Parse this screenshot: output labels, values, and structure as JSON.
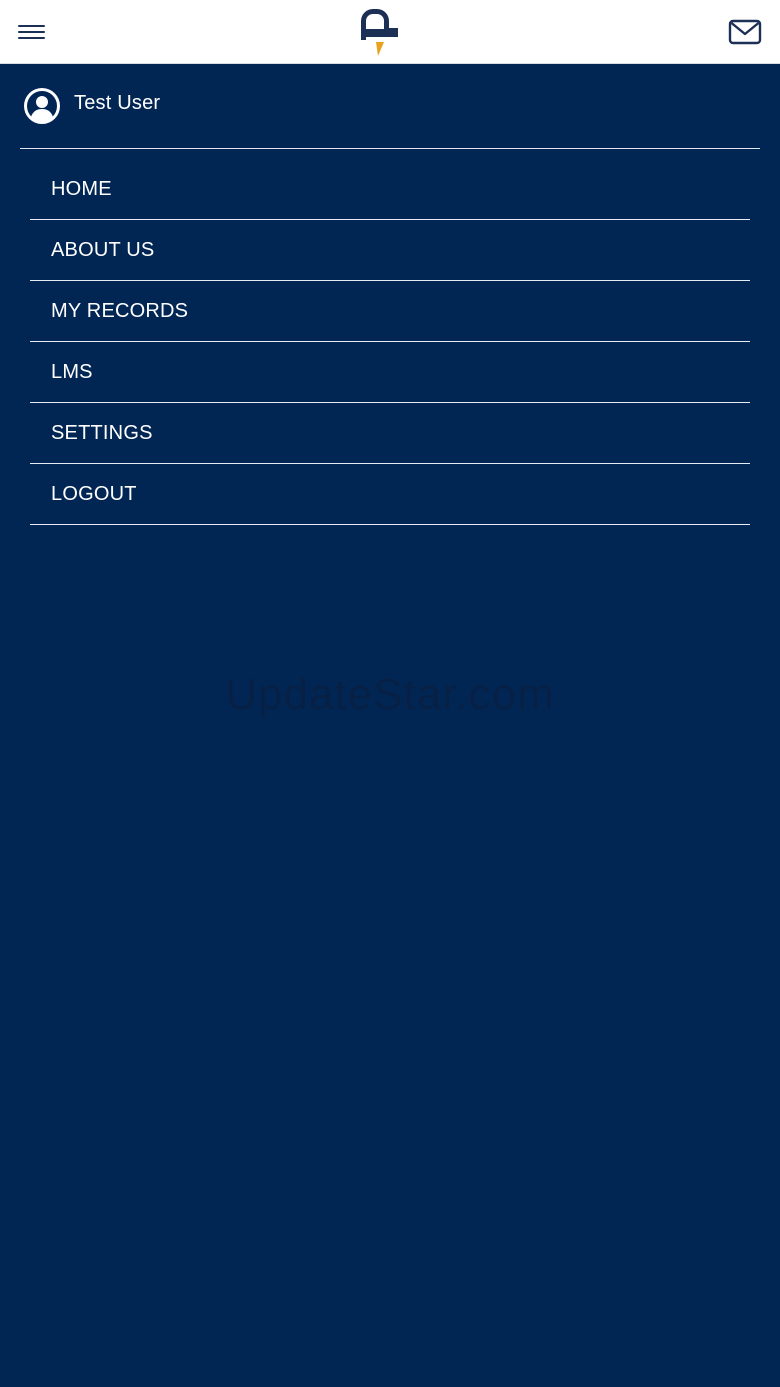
{
  "header": {
    "menu_icon": "hamburger-icon",
    "logo_icon": "app-logo",
    "mail_icon": "mail-icon",
    "accent_color": "#e9a21b",
    "brand_color": "#1c2f55"
  },
  "drawer": {
    "background": "#022654",
    "user": {
      "avatar_icon": "user-circle-icon",
      "name": "Test User"
    },
    "items": [
      {
        "label": "HOME"
      },
      {
        "label": "ABOUT US"
      },
      {
        "label": "MY RECORDS"
      },
      {
        "label": "LMS"
      },
      {
        "label": "SETTINGS"
      },
      {
        "label": "LOGOUT"
      }
    ]
  },
  "watermark": "UpdateStar.com"
}
